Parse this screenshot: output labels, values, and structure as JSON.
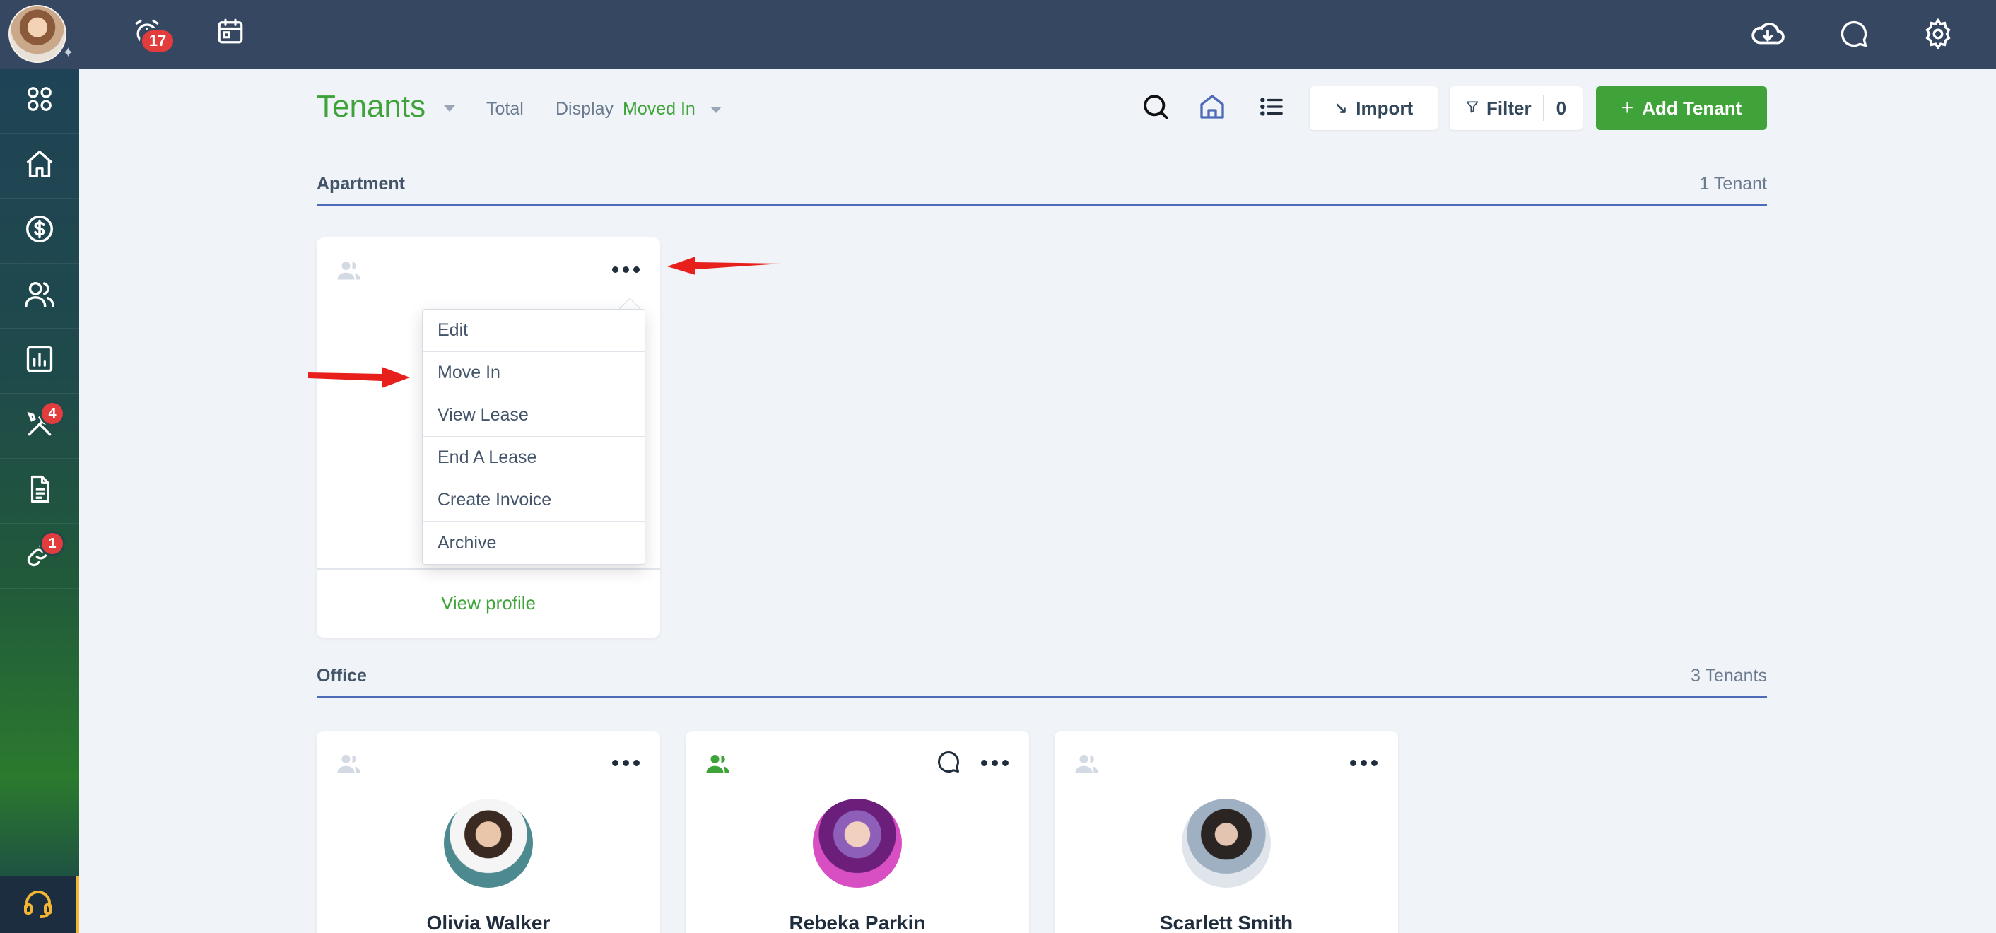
{
  "topbar": {
    "notifications_badge": "17",
    "icons": [
      "alarm-icon",
      "calendar-icon",
      "cloud-download-icon",
      "chat-icon",
      "gear-icon"
    ]
  },
  "sidebar": {
    "items": [
      {
        "icon": "apps-grid-icon"
      },
      {
        "icon": "home-icon"
      },
      {
        "icon": "dollar-icon"
      },
      {
        "icon": "people-icon"
      },
      {
        "icon": "reports-icon"
      },
      {
        "icon": "tools-icon",
        "badge": "4"
      },
      {
        "icon": "document-icon"
      },
      {
        "icon": "link-icon",
        "badge": "1"
      }
    ],
    "support_icon": "headset-icon"
  },
  "header": {
    "title": "Tenants",
    "total_label": "Total",
    "display_label": "Display",
    "display_value": "Moved In",
    "import_label": "Import",
    "filter_label": "Filter",
    "filter_count": "0",
    "add_label": "Add Tenant"
  },
  "sections": {
    "apartment": {
      "title": "Apartment",
      "count": "1 Tenant"
    },
    "office": {
      "title": "Office",
      "count": "3 Tenants"
    }
  },
  "apartment_card": {
    "view_profile": "View profile"
  },
  "menu": {
    "items": [
      "Edit",
      "Move In",
      "View Lease",
      "End A Lease",
      "Create Invoice",
      "Archive"
    ]
  },
  "office_cards": [
    {
      "name": "Olivia Walker"
    },
    {
      "name": "Rebeka Parkin"
    },
    {
      "name": "Scarlett Smith"
    }
  ],
  "colors": {
    "topbar": "#354761",
    "accent_green": "#3fa33a",
    "badge_red": "#e23c3c",
    "section_line": "#4e6bb8",
    "annotation_arrow": "#e8201c"
  }
}
